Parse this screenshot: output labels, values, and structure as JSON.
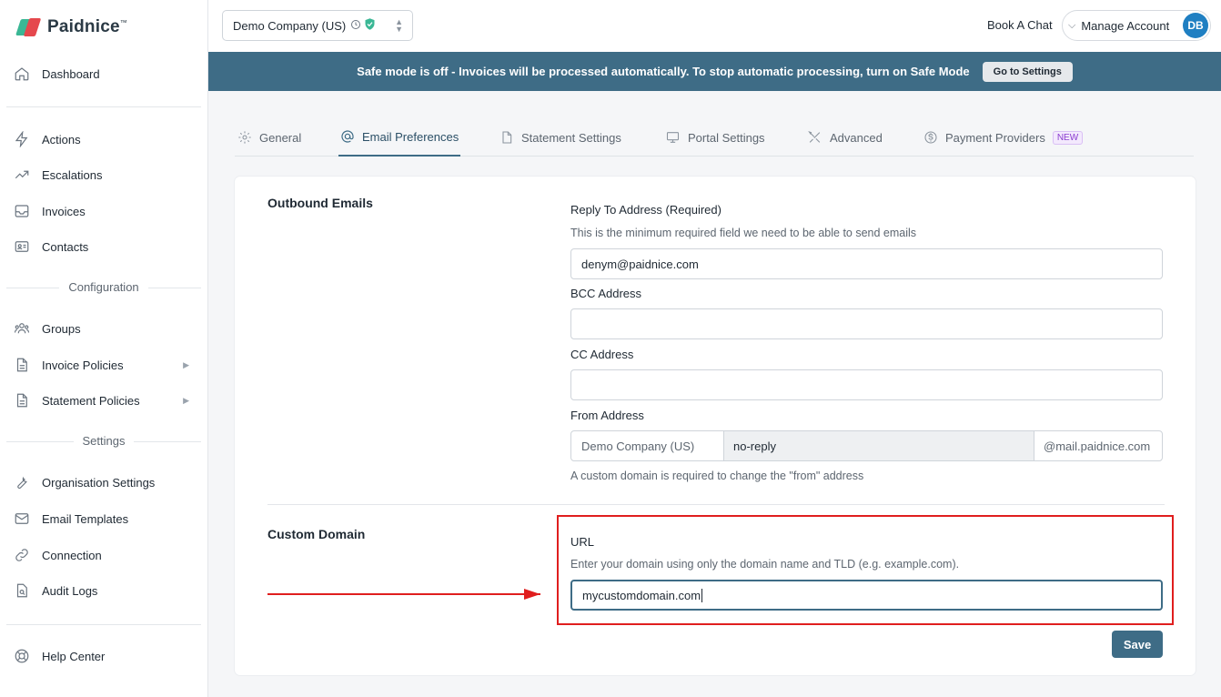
{
  "brand": {
    "name": "Paidnice",
    "tm": "™"
  },
  "sidebar": {
    "items": [
      {
        "label": "Dashboard",
        "icon": "home-icon"
      },
      {
        "label": "Actions",
        "icon": "lightning-icon"
      },
      {
        "label": "Escalations",
        "icon": "trend-up-icon"
      },
      {
        "label": "Invoices",
        "icon": "inbox-icon"
      },
      {
        "label": "Contacts",
        "icon": "id-card-icon"
      },
      {
        "label": "Groups",
        "icon": "users-icon"
      },
      {
        "label": "Invoice Policies",
        "icon": "document-icon"
      },
      {
        "label": "Statement Policies",
        "icon": "document-icon"
      },
      {
        "label": "Organisation Settings",
        "icon": "wrench-icon"
      },
      {
        "label": "Email Templates",
        "icon": "envelope-icon"
      },
      {
        "label": "Connection",
        "icon": "link-icon"
      },
      {
        "label": "Audit Logs",
        "icon": "file-search-icon"
      },
      {
        "label": "Help Center",
        "icon": "lifebuoy-icon"
      }
    ],
    "section_configuration": "Configuration",
    "section_settings": "Settings"
  },
  "topbar": {
    "company": "Demo Company (US)",
    "book_chat": "Book A Chat",
    "manage_account": "Manage Account",
    "avatar_initials": "DB"
  },
  "banner": {
    "text": "Safe mode is off - Invoices will be processed automatically. To stop automatic processing, turn on Safe Mode",
    "button": "Go to Settings"
  },
  "tabs": [
    {
      "label": "General",
      "icon": "gear-icon"
    },
    {
      "label": "Email Preferences",
      "icon": "at-icon"
    },
    {
      "label": "Statement Settings",
      "icon": "document-icon"
    },
    {
      "label": "Portal Settings",
      "icon": "monitor-icon"
    },
    {
      "label": "Advanced",
      "icon": "tools-icon"
    },
    {
      "label": "Payment Providers",
      "icon": "dollar-circle-icon",
      "badge": "NEW"
    }
  ],
  "outbound": {
    "title": "Outbound Emails",
    "reply_to_label": "Reply To Address (Required)",
    "reply_to_help": "This is the minimum required field we need to be able to send emails",
    "reply_to_value": "denym@paidnice.com",
    "bcc_label": "BCC Address",
    "bcc_value": "",
    "cc_label": "CC Address",
    "cc_value": "",
    "from_label": "From Address",
    "from_prefix": "Demo Company (US)",
    "from_local": "no-reply",
    "from_suffix": "@mail.paidnice.com",
    "from_help": "A custom domain is required to change the \"from\" address"
  },
  "custom_domain": {
    "title": "Custom Domain",
    "url_label": "URL",
    "url_help": "Enter your domain using only the domain name and TLD (e.g. example.com).",
    "url_value": "mycustomdomain.com"
  },
  "save_label": "Save",
  "colors": {
    "primary": "#3e6c86",
    "annotation": "#e01e1e",
    "accent_green": "#3ab795",
    "accent_red": "#e5484d"
  }
}
